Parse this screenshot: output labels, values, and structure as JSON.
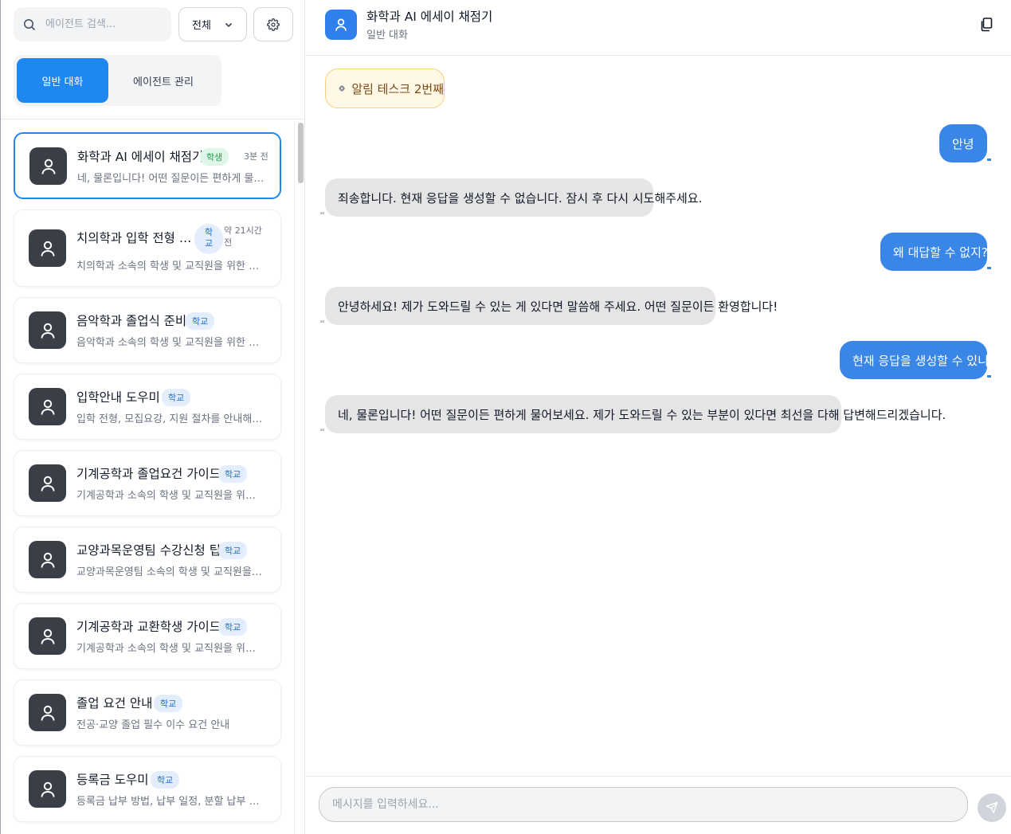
{
  "sidebar": {
    "search": {
      "placeholder": "에이전트 검색..."
    },
    "filter": {
      "selected": "전체"
    },
    "tabs": [
      {
        "label": "일반 대화",
        "active": true
      },
      {
        "label": "에이전트 관리",
        "active": false
      }
    ],
    "agents": [
      {
        "title": "화학과 AI 에세이 채점기",
        "badge": "학생",
        "time": "3분 전",
        "desc": "네, 물론입니다! 어떤 질문이든 편하게 물어보세요.",
        "selected": true
      },
      {
        "title": "치의학과 입학 전형 …",
        "badge": "학교",
        "time": "약 21시간 전",
        "desc": "치의학과 소속의 학생 및 교직원을 위한 입학 전형 안내",
        "selected": false
      },
      {
        "title": "음악학과 졸업식 준비",
        "badge": "학교",
        "time": "",
        "desc": "음악학과 소속의 학생 및 교직원을 위한 졸업식 준비 안내",
        "selected": false
      },
      {
        "title": "입학안내 도우미",
        "badge": "학교",
        "time": "",
        "desc": "입학 전형, 모집요강, 지원 절차를 안내해주는 도우미",
        "selected": false
      },
      {
        "title": "기계공학과 졸업요건 가이드",
        "badge": "학교",
        "time": "",
        "desc": "기계공학과 소속의 학생 및 교직원을 위한 졸업요건 가이드",
        "selected": false
      },
      {
        "title": "교양과목운영팀 수강신청 팁",
        "badge": "학교",
        "time": "",
        "desc": "교양과목운영팀 소속의 학생 및 교직원을 위한 수강신청 팁",
        "selected": false
      },
      {
        "title": "기계공학과 교환학생 가이드",
        "badge": "학교",
        "time": "",
        "desc": "기계공학과 소속의 학생 및 교직원을 위한 교환학생 가이드",
        "selected": false
      },
      {
        "title": "졸업 요건 안내",
        "badge": "학교",
        "time": "",
        "desc": "전공·교양 졸업 필수 이수 요건 안내",
        "selected": false
      },
      {
        "title": "등록금 도우미",
        "badge": "학교",
        "time": "",
        "desc": "등록금 납부 방법, 납부 일정, 분할 납부 등 안내",
        "selected": false
      }
    ]
  },
  "chat": {
    "title": "화학과 AI 에세이 채점기",
    "subtitle": "일반 대화",
    "notice": "알림 테스크 2번째",
    "messages": [
      {
        "role": "user",
        "text": "안녕"
      },
      {
        "role": "bot",
        "text": "죄송합니다. 현재 응답을 생성할 수 없습니다. 잠시 후 다시 시도해주세요."
      },
      {
        "role": "user",
        "text": "왜 대답할 수 없지?"
      },
      {
        "role": "bot",
        "text": "안녕하세요! 제가 도와드릴 수 있는 게 있다면 말씀해 주세요. 어떤 질문이든 환영합니다!"
      },
      {
        "role": "user",
        "text": "현재 응답을 생성할 수 있니"
      },
      {
        "role": "bot",
        "text": "네, 물론입니다! 어떤 질문이든 편하게 물어보세요. 제가 도와드릴 수 있는 부분이 있다면 최선을 다해 답변해드리겠습니다."
      }
    ],
    "composer": {
      "placeholder": "메시지를 입력하세요..."
    }
  },
  "colors": {
    "accent": "#1e88f0",
    "user_bubble": "#3a86e6",
    "bot_bubble": "#e5e5e5",
    "avatar_dark": "#3a3f47"
  },
  "icons": {
    "search": "search-icon",
    "filter_chevron": "chevron-down-icon",
    "settings": "gear-icon",
    "agent": "user-icon",
    "copy": "copy-icon",
    "notice": "gear-emoji-icon",
    "send": "send-icon"
  }
}
